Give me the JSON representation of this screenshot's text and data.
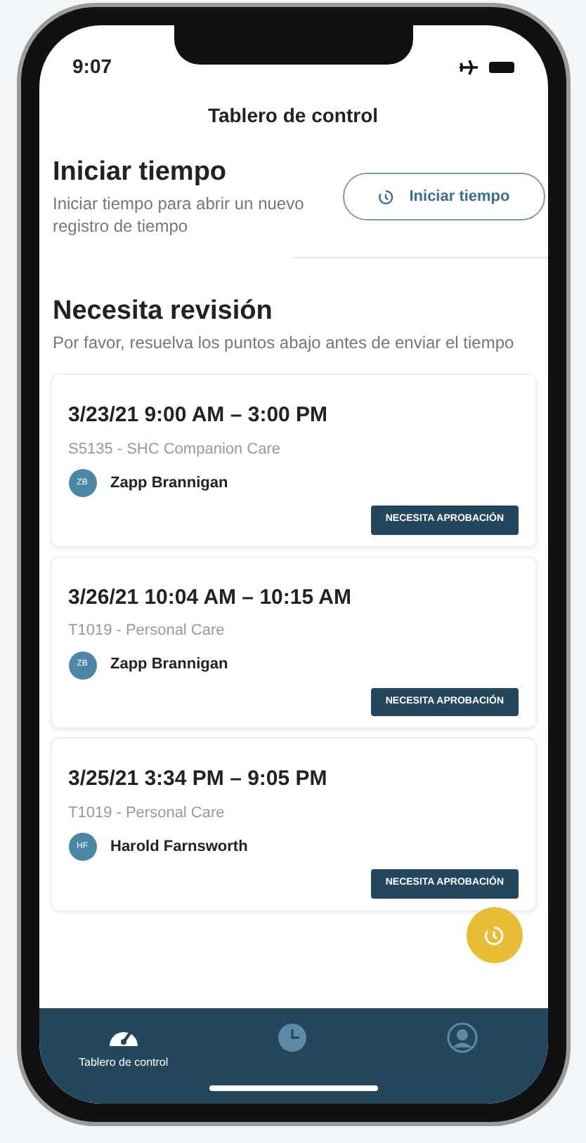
{
  "status_bar": {
    "time": "9:07"
  },
  "header": {
    "title": "Tablero de control"
  },
  "start_section": {
    "title": "Iniciar tiempo",
    "description": "Iniciar tiempo para abrir un nuevo registro de tiempo",
    "button": "Iniciar tiempo"
  },
  "review_section": {
    "title": "Necesita revisión",
    "description": "Por favor, resuelva los puntos abajo antes de enviar el tiempo"
  },
  "entries": [
    {
      "time_range": "3/23/21 9:00 AM – 3:00 PM",
      "service": "S5135 - SHC Companion Care",
      "initials": "ZB",
      "person": "Zapp Brannigan",
      "badge": "NECESITA APROBACIÓN"
    },
    {
      "time_range": "3/26/21 10:04 AM – 10:15 AM",
      "service": "T1019 - Personal Care",
      "initials": "ZB",
      "person": "Zapp Brannigan",
      "badge": "NECESITA APROBACIÓN"
    },
    {
      "time_range": "3/25/21 3:34 PM – 9:05 PM",
      "service": "T1019 - Personal Care",
      "initials": "HF",
      "person": "Harold Farnsworth",
      "badge": "NECESITA APROBACIÓN"
    }
  ],
  "tabs": [
    {
      "kind": "dashboard",
      "label": "Tablero de control",
      "selected": true
    },
    {
      "kind": "clock",
      "selected": false
    },
    {
      "kind": "person",
      "selected": false
    }
  ]
}
